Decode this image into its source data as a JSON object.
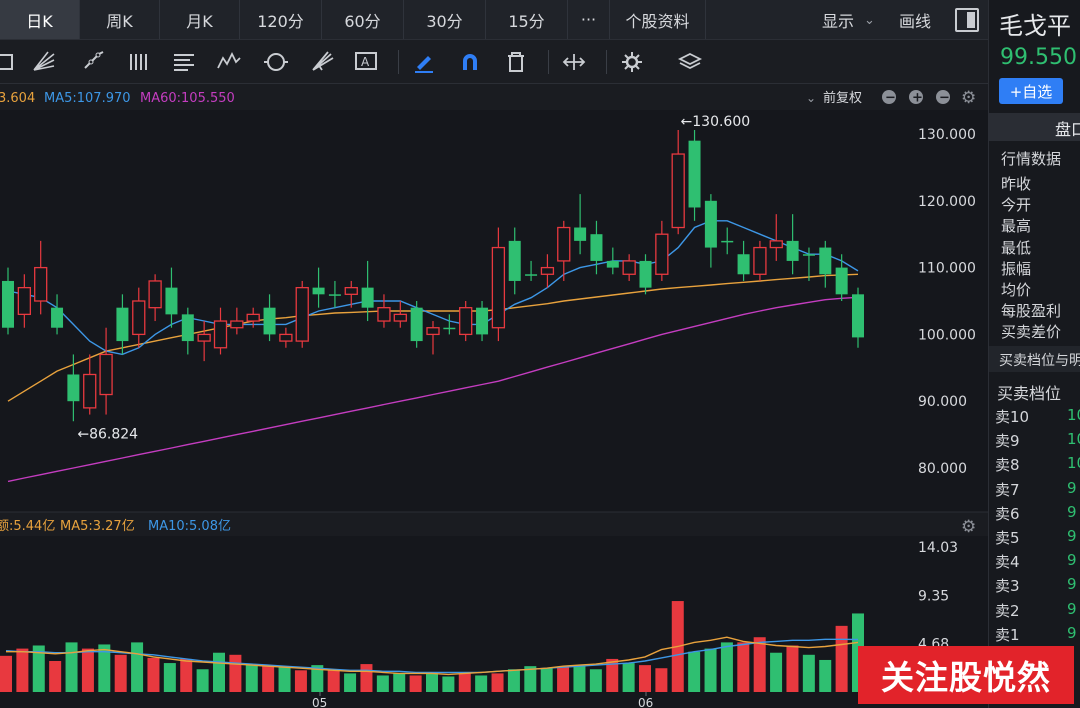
{
  "tabs": [
    "日K",
    "周K",
    "月K",
    "120分",
    "60分",
    "30分",
    "15分",
    "···",
    "个股资料"
  ],
  "active_tab": 0,
  "toolbar_right": {
    "display_label": "显示",
    "draw_label": "画线"
  },
  "tools": [
    "rect-tool-icon",
    "fan-tool-icon",
    "pen-tool-icon",
    "parallel-lines-icon",
    "fib-lines-icon",
    "wave-tool-icon",
    "cycle-tool-icon",
    "gann-fan-icon",
    "text-annotation-icon",
    "marker-pen-icon",
    "magnet-icon",
    "trash-icon",
    "compress-icon",
    "settings-gear-icon",
    "layers-icon"
  ],
  "price_legend": {
    "ma_first": "3.604",
    "ma5": "MA5:107.970",
    "ma60": "MA60:105.550",
    "adjust": "前复权"
  },
  "vol_legend": {
    "vol": "额:5.44亿",
    "ma5": "MA5:3.27亿",
    "ma10": "MA10:5.08亿"
  },
  "price_annotations": {
    "high": "←130.600",
    "low": "←86.824"
  },
  "date_labels": [
    "05",
    "06"
  ],
  "colors": {
    "up": "#e8393f",
    "down": "#2fbf71",
    "ma_blue": "#3d97e6",
    "ma_orange": "#e8a23d",
    "ma_pink": "#c43dc0",
    "accent_blue": "#2f7ef5",
    "watermark": "#e2232a"
  },
  "right_panel": {
    "stock_name": "毛戈平",
    "price": "99.550",
    "add_watch": "+自选",
    "section_tab": "盘口",
    "quote_title": "行情数据",
    "quote_labels": [
      "昨收",
      "今开",
      "最高",
      "最低",
      "振幅",
      "均价",
      "每股盈利",
      "买卖差价"
    ],
    "depth_title": "买卖档位与明",
    "depth_sub": "买卖档位",
    "sells": [
      {
        "label": "卖10",
        "value": "10"
      },
      {
        "label": "卖9",
        "value": "10"
      },
      {
        "label": "卖8",
        "value": "10"
      },
      {
        "label": "卖7",
        "value": "9"
      },
      {
        "label": "卖6",
        "value": "9"
      },
      {
        "label": "卖5",
        "value": "9"
      },
      {
        "label": "卖4",
        "value": "9"
      },
      {
        "label": "卖3",
        "value": "9"
      },
      {
        "label": "卖2",
        "value": "9"
      },
      {
        "label": "卖1",
        "value": "9"
      }
    ]
  },
  "watermark": "关注股悦然",
  "chart_data": [
    {
      "type": "candlestick",
      "y_tick_labels": [
        "130.000",
        "120.000",
        "110.000",
        "100.000",
        "90.000",
        "80.000"
      ],
      "ylim": [
        75,
        135
      ],
      "candles": [
        {
          "o": 108,
          "c": 101,
          "h": 110,
          "l": 100
        },
        {
          "o": 103,
          "c": 107,
          "h": 109,
          "l": 101
        },
        {
          "o": 105,
          "c": 110,
          "h": 114,
          "l": 103
        },
        {
          "o": 104,
          "c": 101,
          "h": 106,
          "l": 100
        },
        {
          "o": 94,
          "c": 90,
          "h": 97,
          "l": 87
        },
        {
          "o": 89,
          "c": 94,
          "h": 97,
          "l": 88
        },
        {
          "o": 91,
          "c": 97,
          "h": 101,
          "l": 88
        },
        {
          "o": 104,
          "c": 99,
          "h": 106,
          "l": 97
        },
        {
          "o": 100,
          "c": 105,
          "h": 107,
          "l": 98
        },
        {
          "o": 104,
          "c": 108,
          "h": 109,
          "l": 102
        },
        {
          "o": 107,
          "c": 103,
          "h": 110,
          "l": 101
        },
        {
          "o": 103,
          "c": 99,
          "h": 104,
          "l": 97
        },
        {
          "o": 99,
          "c": 100,
          "h": 102,
          "l": 96
        },
        {
          "o": 98,
          "c": 102,
          "h": 104,
          "l": 97
        },
        {
          "o": 101,
          "c": 102,
          "h": 104,
          "l": 100
        },
        {
          "o": 102,
          "c": 103,
          "h": 104,
          "l": 101
        },
        {
          "o": 104,
          "c": 100,
          "h": 106,
          "l": 99
        },
        {
          "o": 99,
          "c": 100,
          "h": 101,
          "l": 98
        },
        {
          "o": 99,
          "c": 107,
          "h": 108,
          "l": 98
        },
        {
          "o": 107,
          "c": 106,
          "h": 110,
          "l": 104
        },
        {
          "o": 106,
          "c": 106,
          "h": 108,
          "l": 104
        },
        {
          "o": 106,
          "c": 107,
          "h": 108,
          "l": 104
        },
        {
          "o": 107,
          "c": 104,
          "h": 111,
          "l": 102
        },
        {
          "o": 102,
          "c": 104,
          "h": 106,
          "l": 101
        },
        {
          "o": 102,
          "c": 103,
          "h": 105,
          "l": 101
        },
        {
          "o": 104,
          "c": 99,
          "h": 105,
          "l": 98
        },
        {
          "o": 100,
          "c": 101,
          "h": 102,
          "l": 97
        },
        {
          "o": 101,
          "c": 101,
          "h": 103,
          "l": 100
        },
        {
          "o": 100,
          "c": 104,
          "h": 105,
          "l": 99
        },
        {
          "o": 104,
          "c": 100,
          "h": 105,
          "l": 99
        },
        {
          "o": 101,
          "c": 113,
          "h": 116,
          "l": 99
        },
        {
          "o": 114,
          "c": 108,
          "h": 116,
          "l": 106
        },
        {
          "o": 109,
          "c": 109,
          "h": 111,
          "l": 108
        },
        {
          "o": 109,
          "c": 110,
          "h": 112,
          "l": 107
        },
        {
          "o": 111,
          "c": 116,
          "h": 117,
          "l": 108
        },
        {
          "o": 116,
          "c": 114,
          "h": 121,
          "l": 112
        },
        {
          "o": 115,
          "c": 111,
          "h": 117,
          "l": 109
        },
        {
          "o": 111,
          "c": 110,
          "h": 113,
          "l": 109
        },
        {
          "o": 109,
          "c": 111,
          "h": 112,
          "l": 108
        },
        {
          "o": 111,
          "c": 107,
          "h": 112,
          "l": 106
        },
        {
          "o": 109,
          "c": 115,
          "h": 117,
          "l": 108
        },
        {
          "o": 116,
          "c": 127,
          "h": 130.6,
          "l": 115
        },
        {
          "o": 129,
          "c": 119,
          "h": 130.6,
          "l": 117
        },
        {
          "o": 120,
          "c": 113,
          "h": 121,
          "l": 110
        },
        {
          "o": 114,
          "c": 114,
          "h": 116,
          "l": 112
        },
        {
          "o": 112,
          "c": 109,
          "h": 114,
          "l": 108
        },
        {
          "o": 109,
          "c": 113,
          "h": 114,
          "l": 108
        },
        {
          "o": 113,
          "c": 114,
          "h": 118,
          "l": 111
        },
        {
          "o": 114,
          "c": 111,
          "h": 118,
          "l": 109
        },
        {
          "o": 112,
          "c": 112,
          "h": 113,
          "l": 108
        },
        {
          "o": 113,
          "c": 109,
          "h": 114,
          "l": 107
        },
        {
          "o": 110,
          "c": 106,
          "h": 112,
          "l": 105
        },
        {
          "o": 106,
          "c": 99.55,
          "h": 107,
          "l": 98
        }
      ],
      "ma5": [
        106.5,
        106,
        105.5,
        104,
        101.5,
        99,
        97.5,
        97,
        98,
        100,
        101.5,
        102.5,
        102,
        101.5,
        101.5,
        101.5,
        101.5,
        101.5,
        102.5,
        103.5,
        104,
        104.5,
        105,
        105,
        105,
        104,
        103,
        102,
        101.5,
        101.5,
        103,
        104.5,
        105.5,
        107,
        109,
        110,
        110.5,
        111,
        111,
        110.5,
        111,
        113,
        116,
        117,
        117,
        116,
        115,
        114,
        113,
        112,
        112,
        111,
        109.5
      ],
      "ma10": [],
      "ma60": [
        78,
        78.5,
        79,
        79.5,
        80,
        80.5,
        81,
        81.5,
        82,
        82.5,
        83,
        83.5,
        84,
        84.5,
        85,
        85.5,
        86,
        86.5,
        87,
        87.5,
        88,
        88.5,
        89,
        89.5,
        90,
        90.5,
        91,
        91.5,
        92,
        92.5,
        93,
        93.7,
        94.4,
        95.1,
        95.8,
        96.5,
        97.2,
        97.9,
        98.6,
        99.3,
        100,
        100.6,
        101.2,
        101.8,
        102.4,
        103,
        103.5,
        104,
        104.4,
        104.8,
        105.2,
        105.4,
        105.55
      ],
      "ma_orange": [
        90,
        91.5,
        93,
        94.5,
        95.5,
        96.5,
        97.5,
        98,
        98.5,
        99,
        99.5,
        100,
        100.5,
        101,
        101.5,
        102,
        102.3,
        102.5,
        102.8,
        103,
        103.2,
        103.3,
        103.4,
        103.5,
        103.5,
        103.5,
        103.5,
        103.5,
        103.5,
        103.5,
        103.7,
        104,
        104.3,
        104.6,
        105,
        105.3,
        105.6,
        105.9,
        106.2,
        106.5,
        106.8,
        107,
        107.2,
        107.4,
        107.6,
        107.8,
        108,
        108.2,
        108.4,
        108.6,
        108.8,
        108.9,
        109
      ]
    },
    {
      "type": "bar",
      "y_tick_labels": [
        "14.03",
        "9.35",
        "4.68"
      ],
      "ylim": [
        0,
        14.03
      ],
      "values": [
        3.5,
        4.2,
        4.5,
        3,
        4.8,
        4.2,
        4.6,
        3.6,
        4.8,
        3.3,
        2.8,
        3.2,
        2.2,
        3.8,
        3.6,
        2.7,
        2.6,
        2.4,
        2.1,
        2.6,
        2.1,
        1.8,
        2.7,
        1.6,
        1.8,
        1.6,
        1.8,
        1.5,
        1.8,
        1.6,
        1.8,
        2.2,
        2.5,
        2.3,
        2.4,
        2.6,
        2.2,
        3.2,
        2.8,
        2.6,
        2.3,
        8.8,
        3.9,
        4.2,
        4.8,
        4.8,
        5.3,
        3.8,
        4.5,
        3.6,
        3.1,
        6.4,
        7.6
      ],
      "up_flags": [
        true,
        true,
        false,
        true,
        false,
        true,
        false,
        true,
        false,
        true,
        false,
        true,
        false,
        false,
        true,
        false,
        true,
        false,
        true,
        false,
        true,
        false,
        true,
        false,
        false,
        true,
        false,
        false,
        true,
        false,
        true,
        false,
        false,
        false,
        true,
        false,
        false,
        true,
        false,
        true,
        true,
        true,
        false,
        false,
        false,
        true,
        true,
        false,
        true,
        false,
        false,
        true,
        false
      ],
      "ma5": [
        3.9,
        3.9,
        3.8,
        3.7,
        3.8,
        4,
        4.1,
        3.9,
        3.7,
        3.4,
        3.2,
        3,
        2.9,
        2.8,
        2.7,
        2.6,
        2.5,
        2.4,
        2.3,
        2.2,
        2.1,
        2,
        2,
        1.9,
        1.8,
        1.8,
        1.8,
        1.7,
        1.8,
        1.9,
        2,
        2.1,
        2.2,
        2.3,
        2.5,
        2.6,
        2.7,
        2.9,
        3.1,
        3.4,
        4.1,
        4.4,
        4.8,
        5,
        5.3,
        4.9,
        4.7,
        4.5,
        4.4,
        4.3,
        4.4,
        4.6,
        4.8
      ],
      "ma10": [
        4,
        3.9,
        3.9,
        3.8,
        3.8,
        3.9,
        3.9,
        3.8,
        3.7,
        3.6,
        3.4,
        3.2,
        3,
        2.9,
        2.8,
        2.7,
        2.6,
        2.5,
        2.4,
        2.3,
        2.2,
        2.1,
        2.1,
        2,
        2,
        1.9,
        1.9,
        1.9,
        1.9,
        1.9,
        2,
        2.1,
        2.2,
        2.3,
        2.4,
        2.5,
        2.6,
        2.7,
        2.8,
        3,
        3.3,
        3.6,
        3.9,
        4.1,
        4.4,
        4.6,
        4.8,
        4.9,
        5,
        5,
        5.1,
        5.1,
        5.08
      ]
    }
  ]
}
